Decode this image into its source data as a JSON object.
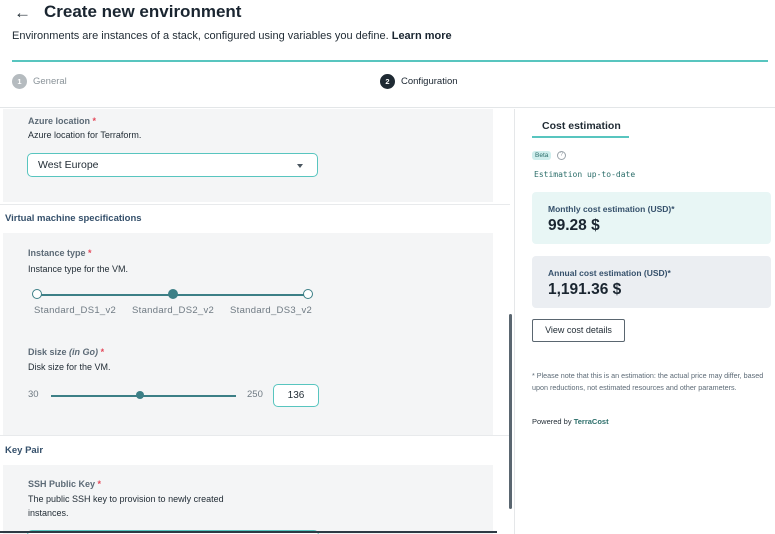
{
  "header": {
    "title": "Create new environment",
    "subtitle": "Environments are instances of a stack, configured using variables you define.",
    "learn_more": "Learn more"
  },
  "stepper": {
    "steps": [
      {
        "number": "1",
        "label": "General"
      },
      {
        "number": "2",
        "label": "Configuration"
      }
    ],
    "active_step": 2
  },
  "form": {
    "azure_location": {
      "label": "Azure location",
      "required_mark": "*",
      "description": "Azure location for Terraform.",
      "value": "West Europe"
    },
    "vm_section_title": "Virtual machine specifications",
    "instance_type": {
      "label": "Instance type",
      "required_mark": "*",
      "description": "Instance type for the VM.",
      "options": [
        "Standard_DS1_v2",
        "Standard_DS2_v2",
        "Standard_DS3_v2"
      ],
      "selected_index": 1
    },
    "disk_size": {
      "label": "Disk size",
      "unit": "(in Go)",
      "required_mark": "*",
      "description": "Disk size for the VM.",
      "min": "30",
      "max": "250",
      "value": "136"
    },
    "key_pair_section_title": "Key Pair",
    "ssh_key": {
      "label": "SSH Public Key",
      "required_mark": "*",
      "description_line1": "The public SSH key to provision to newly created",
      "description_line2": "instances."
    }
  },
  "cost": {
    "tab_title": "Cost estimation",
    "beta_badge": "Beta",
    "help_icon": "?",
    "status": "Estimation up-to-date",
    "monthly_label": "Monthly cost estimation (USD)*",
    "monthly_value": "99.28 $",
    "annual_label": "Annual cost estimation (USD)*",
    "annual_value": "1,191.36 $",
    "view_details": "View cost details",
    "note": "* Please note that this is an estimation: the actual price may differ, based upon reductions, not estimated resources and other parameters.",
    "powered_by": "Powered by",
    "powered_by_brand": "TerraCost"
  },
  "colors": {
    "accent": "#58c5bf",
    "slider": "#3c7f86",
    "required": "#e4495b",
    "section_title": "#35506b"
  }
}
